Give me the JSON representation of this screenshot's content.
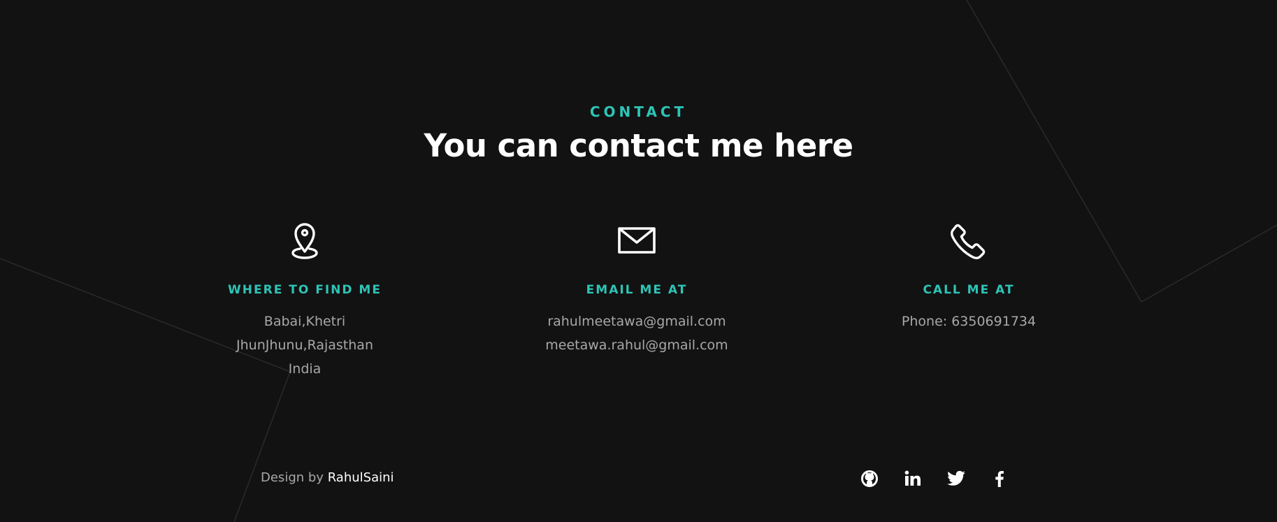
{
  "colors": {
    "background": "#121212",
    "accent": "#2ec4b6",
    "heading": "#ffffff",
    "body_text": "#a8a8a8",
    "decor_lines": "#2a2a2a"
  },
  "header": {
    "eyebrow": "CONTACT",
    "title": "You can contact me here"
  },
  "cards": {
    "location": {
      "icon": "location-pin-icon",
      "title": "WHERE TO FIND ME",
      "lines": [
        "Babai,Khetri",
        "JhunJhunu,Rajasthan",
        "India"
      ]
    },
    "email": {
      "icon": "envelope-icon",
      "title": "EMAIL ME AT",
      "lines": [
        "rahulmeetawa@gmail.com",
        "meetawa.rahul@gmail.com"
      ]
    },
    "phone": {
      "icon": "phone-icon",
      "title": "CALL ME AT",
      "lines": [
        "Phone: 6350691734"
      ]
    }
  },
  "footer": {
    "credit_prefix": "Design by",
    "credit_name": "RahulSaini",
    "socials": [
      {
        "icon": "github-icon"
      },
      {
        "icon": "linkedin-icon"
      },
      {
        "icon": "twitter-icon"
      },
      {
        "icon": "facebook-icon"
      }
    ]
  }
}
